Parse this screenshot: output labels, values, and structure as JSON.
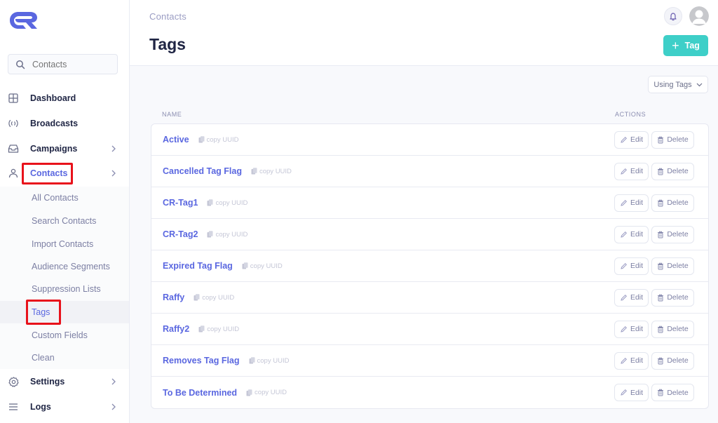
{
  "brand": {
    "logo": "CR-logo",
    "accent": "#5a67e0",
    "primary_button": "#3ecfc8",
    "highlight": "#e8121b"
  },
  "sidebar": {
    "search": {
      "value": "",
      "placeholder": "Contacts",
      "icon": "search-icon"
    },
    "items": [
      {
        "label": "Dashboard",
        "icon": "grid-icon",
        "has_chevron": false
      },
      {
        "label": "Broadcasts",
        "icon": "broadcast-icon",
        "has_chevron": false
      },
      {
        "label": "Campaigns",
        "icon": "inbox-icon",
        "has_chevron": true
      },
      {
        "label": "Contacts",
        "icon": "user-icon",
        "has_chevron": true,
        "active": true
      },
      {
        "label": "Settings",
        "icon": "gear-icon",
        "has_chevron": true
      },
      {
        "label": "Logs",
        "icon": "menu-icon",
        "has_chevron": true
      }
    ],
    "contacts_sub": [
      {
        "label": "All Contacts"
      },
      {
        "label": "Search Contacts"
      },
      {
        "label": "Import Contacts"
      },
      {
        "label": "Audience Segments"
      },
      {
        "label": "Suppression Lists"
      },
      {
        "label": "Tags",
        "active": true
      },
      {
        "label": "Custom Fields"
      },
      {
        "label": "Clean"
      }
    ]
  },
  "header": {
    "breadcrumb": "Contacts",
    "title": "Tags",
    "add_button": {
      "icon": "plus-icon",
      "label": "Tag"
    },
    "bell_icon": "bell-icon",
    "avatar_icon": "user-avatar"
  },
  "filter": {
    "label": "Using Tags"
  },
  "table": {
    "columns": {
      "name": "NAME",
      "actions": "ACTIONS"
    },
    "copy_label": "copy UUID",
    "edit_label": "Edit",
    "delete_label": "Delete",
    "rows": [
      {
        "name": "Active"
      },
      {
        "name": "Cancelled Tag Flag"
      },
      {
        "name": "CR-Tag1"
      },
      {
        "name": "CR-Tag2"
      },
      {
        "name": "Expired Tag Flag"
      },
      {
        "name": "Raffy"
      },
      {
        "name": "Raffy2"
      },
      {
        "name": "Removes Tag Flag"
      },
      {
        "name": "To Be Determined"
      }
    ]
  }
}
